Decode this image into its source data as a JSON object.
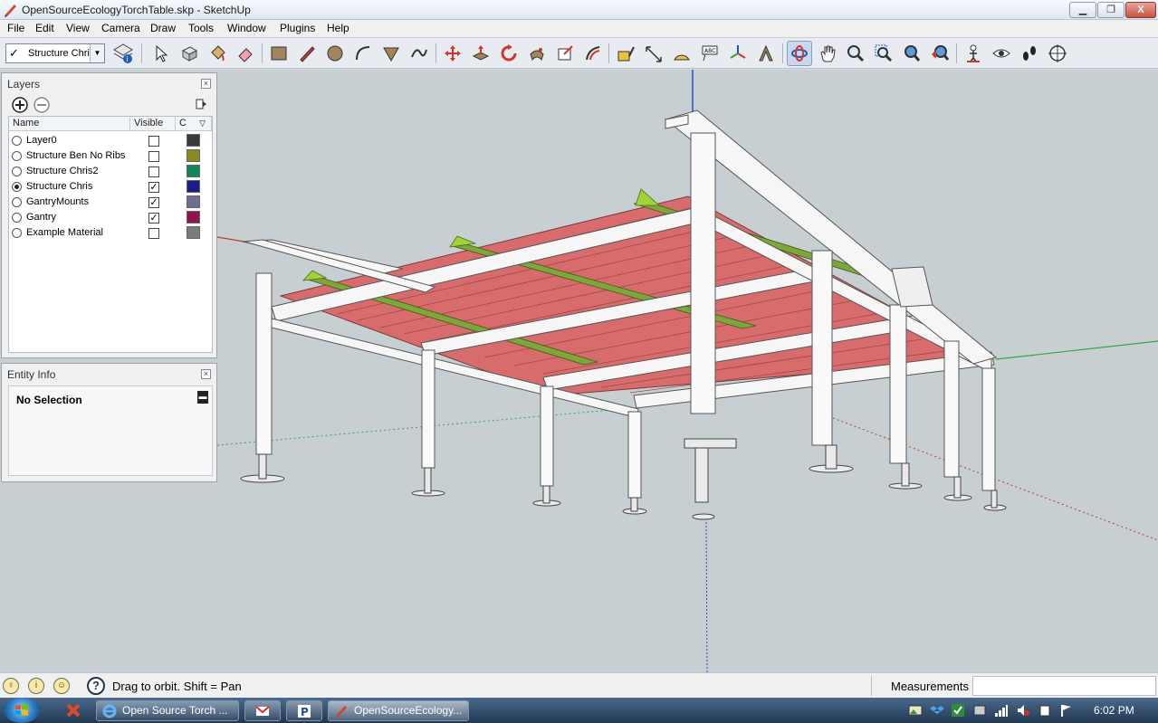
{
  "window": {
    "title": "OpenSourceEcologyTorchTable.skp - SketchUp",
    "minimize": "▁",
    "maximize": "❐",
    "close": "X"
  },
  "menu": [
    "File",
    "Edit",
    "View",
    "Camera",
    "Draw",
    "Tools",
    "Window",
    "Plugins",
    "Help"
  ],
  "toolbar": {
    "active_layer": "Structure Chris",
    "tools": [
      "select-tool",
      "component-tool",
      "paint-bucket-tool",
      "eraser-tool",
      "rectangle-tool",
      "line-tool",
      "circle-tool",
      "arc-tool",
      "polygon-tool",
      "freehand-tool",
      "move-tool",
      "push-pull-tool",
      "rotate-tool",
      "follow-me-tool",
      "scale-tool",
      "offset-tool",
      "tape-measure-tool",
      "dimension-tool",
      "protractor-tool",
      "text-tool",
      "axes-tool",
      "3d-text-tool",
      "orbit-tool",
      "pan-tool",
      "zoom-tool",
      "zoom-window-tool",
      "zoom-extents-tool",
      "previous-view-tool",
      "position-camera-tool",
      "look-around-tool",
      "walk-tool",
      "section-plane-tool"
    ]
  },
  "layers_panel": {
    "title": "Layers",
    "col_name": "Name",
    "col_visible": "Visible",
    "col_color": "C",
    "layers": [
      {
        "name": "Layer0",
        "active": false,
        "visible": false,
        "color": "#3a3a3a"
      },
      {
        "name": "Structure Ben No Ribs",
        "active": false,
        "visible": false,
        "color": "#8a8a1f"
      },
      {
        "name": "Structure Chris2",
        "active": false,
        "visible": false,
        "color": "#14845a"
      },
      {
        "name": "Structure Chris",
        "active": true,
        "visible": true,
        "color": "#1c1c86"
      },
      {
        "name": "GantryMounts",
        "active": false,
        "visible": true,
        "color": "#6e6e90"
      },
      {
        "name": "Gantry",
        "active": false,
        "visible": true,
        "color": "#8c1450"
      },
      {
        "name": "Example Material",
        "active": false,
        "visible": false,
        "color": "#7a7a7a"
      }
    ]
  },
  "entity_panel": {
    "title": "Entity Info",
    "selection": "No Selection"
  },
  "statusbar": {
    "message": "Drag to orbit.  Shift = Pan",
    "measurements_label": "Measurements",
    "measurements_value": ""
  },
  "taskbar": {
    "apps": [
      {
        "label": "Open Source Torch ...",
        "icon": "internet-explorer-icon"
      },
      {
        "label": "OpenSourceEcology...",
        "icon": "sketchup-icon"
      }
    ],
    "clock": "6:02 PM"
  },
  "colors": {
    "viewport_bg": "#c7cfd3",
    "steel": "#f4f4f4",
    "slats": "#d56a6a",
    "ribs": "#6f9a2a",
    "axis_red": "#c0392b",
    "axis_green": "#2ea84a",
    "axis_blue": "#2b48c8"
  }
}
